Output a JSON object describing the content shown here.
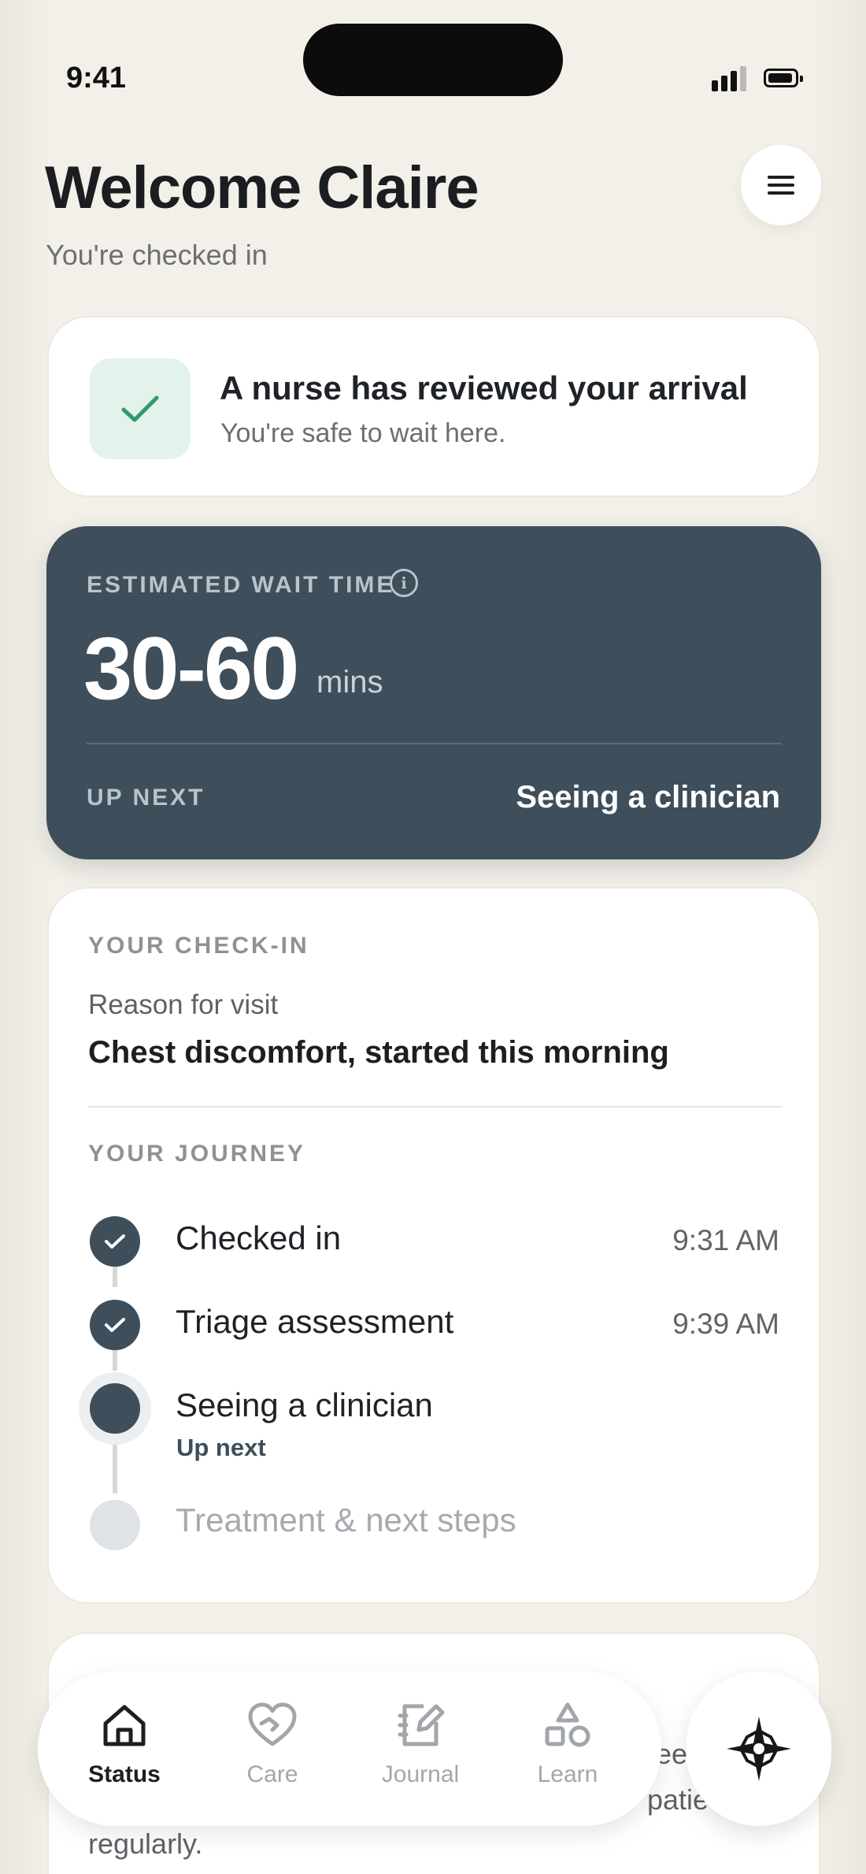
{
  "status_bar": {
    "time": "9:41"
  },
  "header": {
    "title": "Welcome Claire",
    "subtitle": "You're checked in"
  },
  "nurse_card": {
    "title": "A nurse has reviewed your arrival",
    "subtitle": "You're safe to wait here."
  },
  "wait_card": {
    "label": "ESTIMATED WAIT TIME",
    "value": "30-60",
    "unit": "mins",
    "up_next_label": "UP NEXT",
    "up_next_value": "Seeing a clinician"
  },
  "checkin": {
    "section_label": "YOUR CHECK-IN",
    "reason_label": "Reason for visit",
    "reason_value": "Chest discomfort, started this morning",
    "journey_label": "YOUR JOURNEY",
    "steps": [
      {
        "title": "Checked in",
        "time": "9:31 AM",
        "state": "done"
      },
      {
        "title": "Triage assessment",
        "time": "9:39 AM",
        "state": "done"
      },
      {
        "title": "Seeing a clinician",
        "sub": "Up next",
        "state": "current"
      },
      {
        "title": "Treatment & next steps",
        "state": "pending"
      }
    ]
  },
  "partial_card": {
    "fragment_1": "ee",
    "fragment_2": "patie",
    "fragment_3": "regularly."
  },
  "nav": {
    "items": [
      {
        "label": "Status",
        "icon": "home-icon",
        "active": true
      },
      {
        "label": "Care",
        "icon": "heart-hand-icon",
        "active": false
      },
      {
        "label": "Journal",
        "icon": "journal-edit-icon",
        "active": false
      },
      {
        "label": "Learn",
        "icon": "shapes-icon",
        "active": false
      }
    ],
    "fab_icon": "compass-star-icon"
  },
  "colors": {
    "background": "#f1eee6",
    "card": "#ffffff",
    "slate": "#3e4e5a",
    "mint": "#e3f2ea",
    "check_green": "#2f9a6a"
  }
}
